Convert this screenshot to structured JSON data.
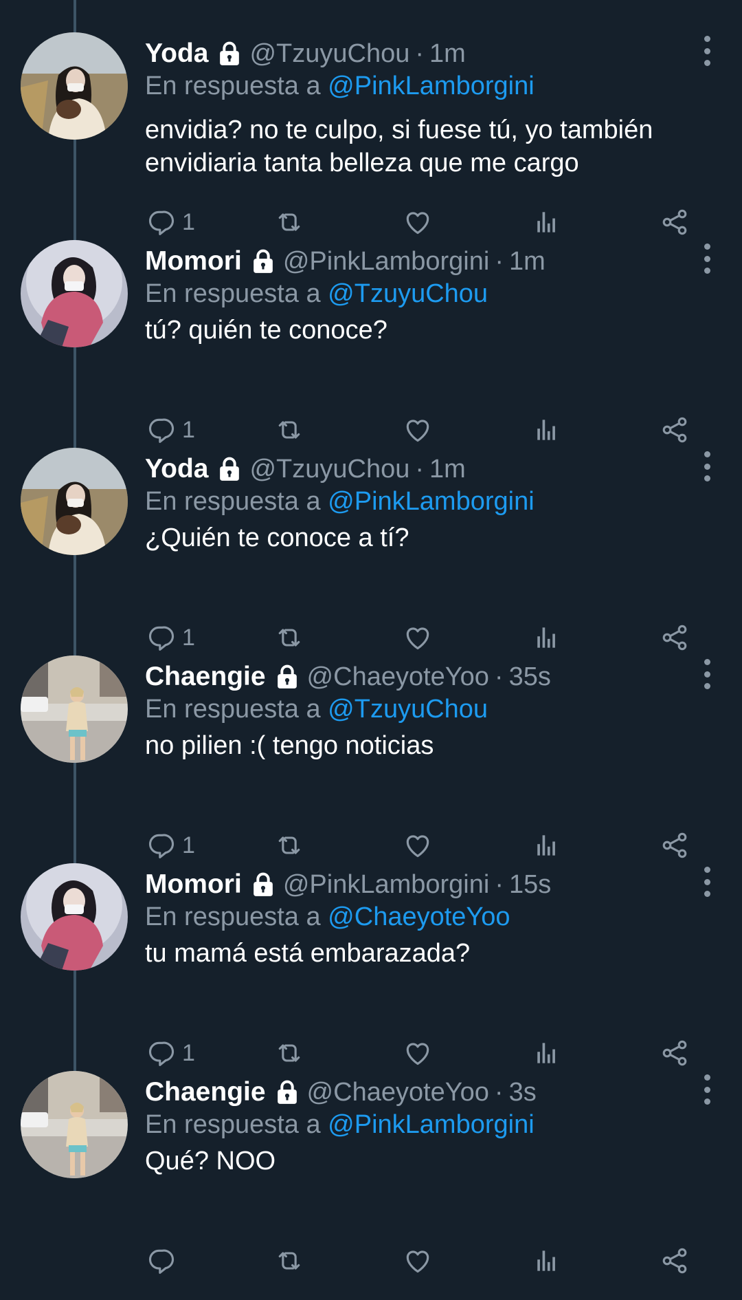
{
  "colors": {
    "background": "#15202b",
    "text_primary": "#ffffff",
    "text_secondary": "#8b98a5",
    "link": "#1d9bf0",
    "thread_line": "#3d5466"
  },
  "icons": {
    "reply": "reply-icon",
    "retweet": "retweet-icon",
    "like": "heart-icon",
    "views": "analytics-icon",
    "share": "share-icon",
    "lock": "lock-icon",
    "more": "more-vertical-icon"
  },
  "thread": {
    "replying_prefix": "En respuesta a",
    "tweets": [
      {
        "name": "Yoda",
        "handle": "@TzuyuChou",
        "separator": "·",
        "time": "1m",
        "reply_to": "@PinkLamborgini",
        "text": "envidia? no te culpo, si fuese tú, yo también envidiaria tanta belleza que me cargo",
        "reply_count": "1",
        "avatar": "yoda"
      },
      {
        "name": "Momori",
        "handle": "@PinkLamborgini",
        "separator": "·",
        "time": "1m",
        "reply_to": "@TzuyuChou",
        "text": "tú? quién te conoce?",
        "reply_count": "1",
        "avatar": "momori"
      },
      {
        "name": "Yoda",
        "handle": "@TzuyuChou",
        "separator": "·",
        "time": "1m",
        "reply_to": "@PinkLamborgini",
        "text": "¿Quién te conoce a tí?",
        "reply_count": "1",
        "avatar": "yoda"
      },
      {
        "name": "Chaengie",
        "handle": "@ChaeyoteYoo",
        "separator": "·",
        "time": "35s",
        "reply_to": "@TzuyuChou",
        "text": "no pilien :( tengo noticias",
        "reply_count": "1",
        "avatar": "chaengie"
      },
      {
        "name": "Momori",
        "handle": "@PinkLamborgini",
        "separator": "·",
        "time": "15s",
        "reply_to": "@ChaeyoteYoo",
        "text": "tu mamá está embarazada?",
        "reply_count": "1",
        "avatar": "momori"
      },
      {
        "name": "Chaengie",
        "handle": "@ChaeyoteYoo",
        "separator": "·",
        "time": "3s",
        "reply_to": "@PinkLamborgini",
        "text": "Qué? NOO",
        "reply_count": "",
        "avatar": "chaengie"
      }
    ]
  }
}
